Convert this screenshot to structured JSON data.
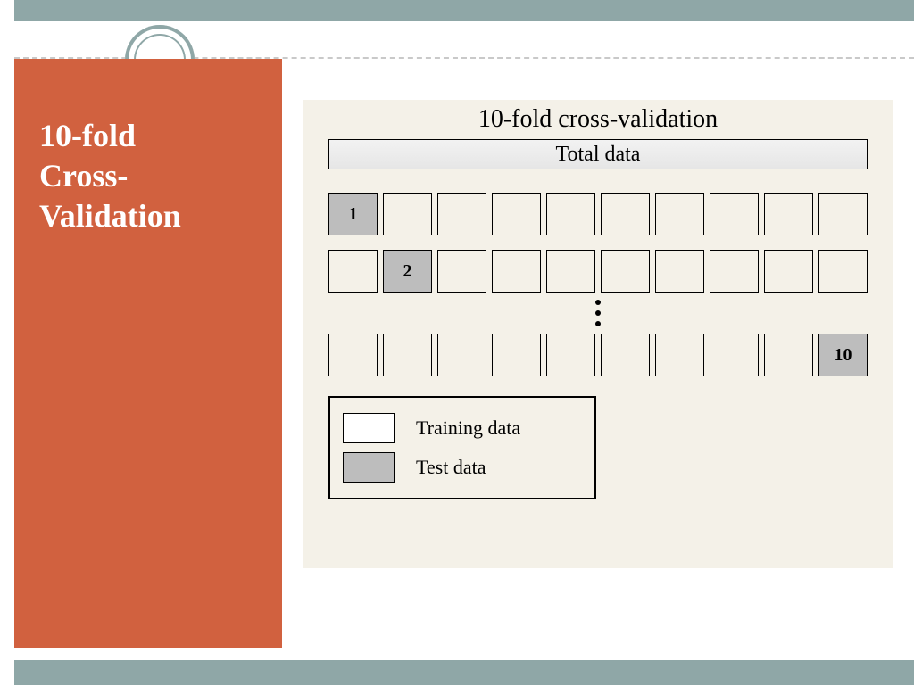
{
  "slide": {
    "title_line1": "10-fold",
    "title_line2": "Cross-",
    "title_line3": "Validation"
  },
  "diagram": {
    "title": "10-fold cross-validation",
    "total_label": "Total data",
    "folds": 10,
    "rows": [
      {
        "test_index": 0,
        "label": "1"
      },
      {
        "test_index": 1,
        "label": "2"
      },
      {
        "test_index": 9,
        "label": "10"
      }
    ],
    "legend": {
      "training": "Training data",
      "test": "Test data"
    }
  }
}
